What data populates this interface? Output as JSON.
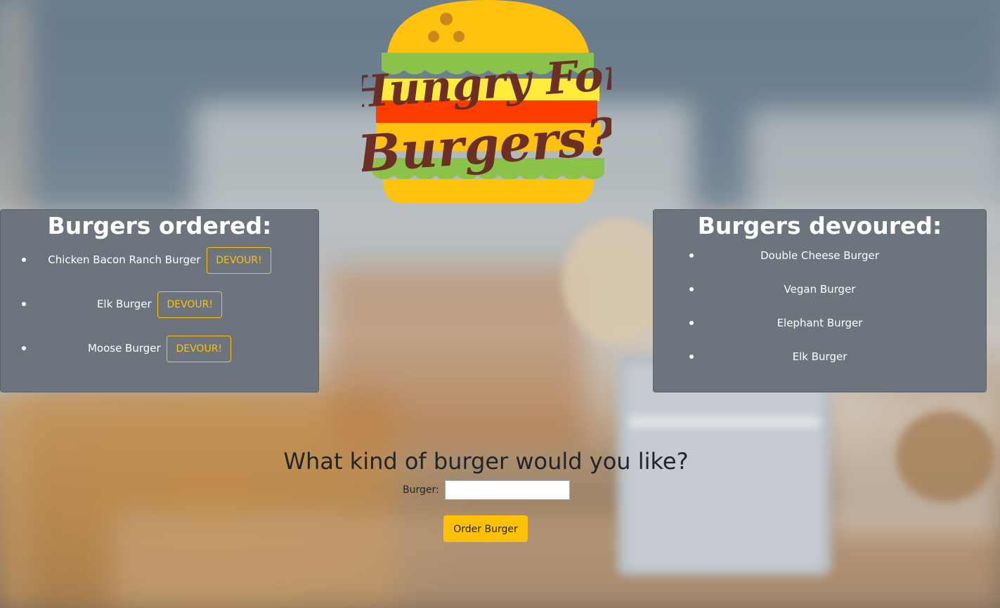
{
  "logo": {
    "line1": "Hungry For",
    "line2": "Burgers?"
  },
  "ordered": {
    "title": "Burgers ordered:",
    "button_label": "DEVOUR!",
    "items": [
      {
        "name": "Chicken Bacon Ranch Burger"
      },
      {
        "name": "Elk Burger"
      },
      {
        "name": "Moose Burger"
      }
    ]
  },
  "devoured": {
    "title": "Burgers devoured:",
    "items": [
      {
        "name": "Double Cheese Burger"
      },
      {
        "name": "Vegan Burger"
      },
      {
        "name": "Elephant Burger"
      },
      {
        "name": "Elk Burger"
      }
    ]
  },
  "form": {
    "title": "What kind of burger would you like?",
    "label": "Burger:",
    "input_value": "",
    "submit_label": "Order Burger"
  },
  "colors": {
    "panel": "#6c757d",
    "accent": "#ffc107",
    "text_dark": "#212529",
    "logo_text": "#6b2f26"
  }
}
